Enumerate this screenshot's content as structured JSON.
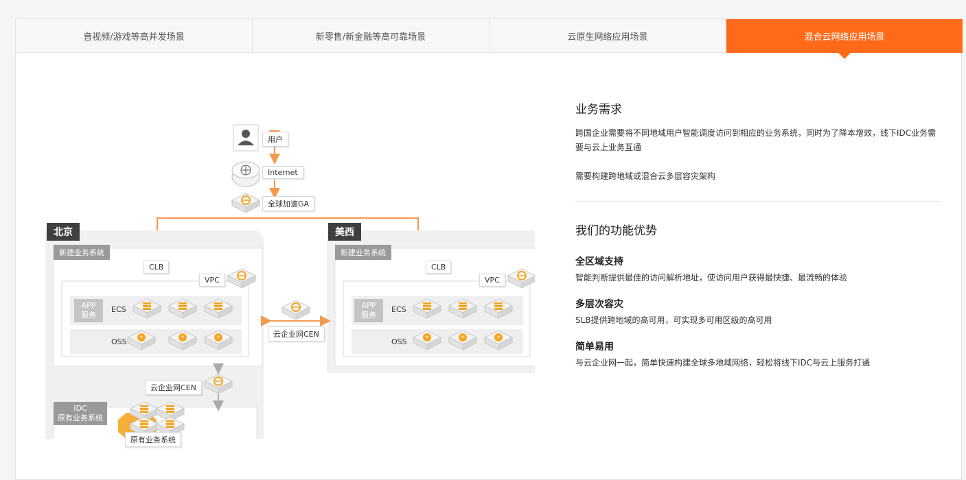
{
  "tabs": [
    {
      "label": "音视频/游戏等高并发场景"
    },
    {
      "label": "新零售/新金融等高可靠场景"
    },
    {
      "label": "云原生网络应用场景"
    },
    {
      "label": "混合云网络应用场景"
    }
  ],
  "diagram": {
    "user": "用户",
    "internet": "Internet",
    "ga": "全球加速GA",
    "region_beijing": "北京",
    "region_uswest": "美西",
    "new_system": "新建业务系统",
    "clb": "CLB",
    "vpc": "VPC",
    "app_line1": "APP",
    "app_line2": "服务",
    "ecs": "ECS",
    "oss": "OSS",
    "cen": "云企业网CEN",
    "idc_line1": "IDC",
    "idc_line2": "原有业务系统",
    "legacy_system": "原有业务系统"
  },
  "content": {
    "requirements_title": "业务需求",
    "requirements_p1": "跨国企业需要将不同地域用户智能调度访问到相应的业务系统，同时为了降本增效，线下IDC业务需要与云上业务互通",
    "requirements_p2": "需要构建跨地域或混合云多层容灾架构",
    "advantages_title": "我们的功能优势",
    "features": [
      {
        "title": "全区域支持",
        "desc": "智能判断提供最佳的访问解析地址，使访问用户获得最快捷、最流畅的体验"
      },
      {
        "title": "多层次容灾",
        "desc": "SLB提供跨地域的高可用，可实现多可用区级的高可用"
      },
      {
        "title": "简单易用",
        "desc": "与云企业网一起，简单快速构建全球多地域网络，轻松将线下IDC与云上服务打通"
      }
    ]
  },
  "colors": {
    "accent": "#ff6a1a",
    "icon_orange": "#f5a623"
  }
}
